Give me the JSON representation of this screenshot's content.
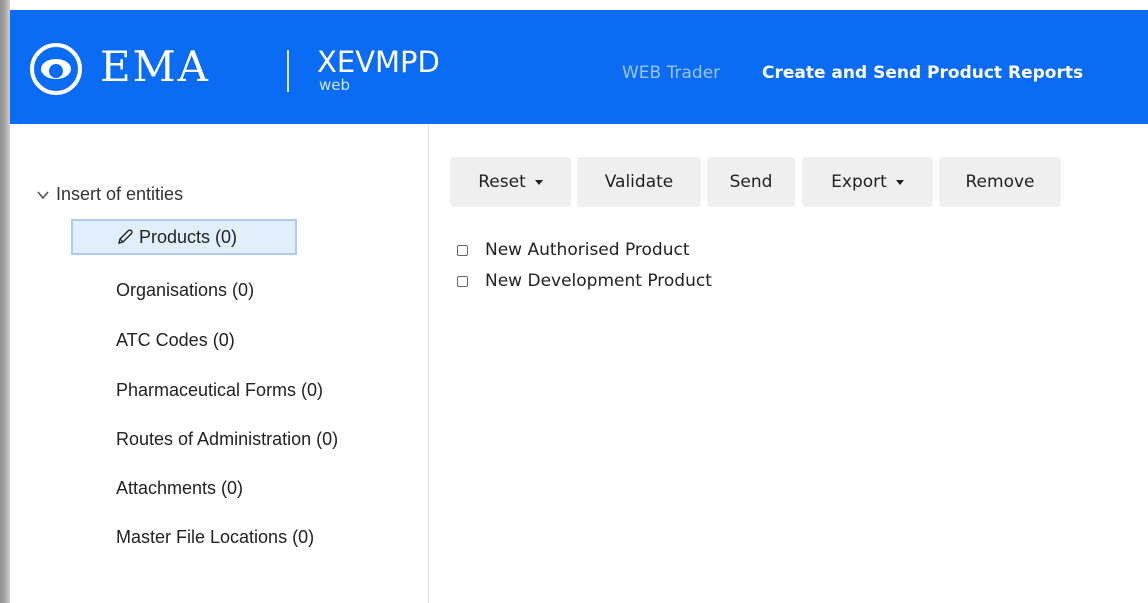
{
  "header": {
    "brand": "EMA",
    "product_name": "XEVMPD",
    "product_sub": "web",
    "nav": [
      {
        "label": "WEB Trader",
        "state": "muted"
      },
      {
        "label": "Create and Send Product Reports",
        "state": "active"
      }
    ],
    "logo_icon": "ema-eye-logo",
    "colors": {
      "header_bg": "#0a6cf4"
    }
  },
  "sidebar": {
    "root_label": "Insert of entities",
    "root_icon": "chevron-down-icon",
    "items": [
      {
        "label": "Products (0)",
        "selected": true,
        "icon": "pencil-icon"
      },
      {
        "label": "Organisations (0)"
      },
      {
        "label": "ATC Codes (0)"
      },
      {
        "label": "Pharmaceutical Forms (0)"
      },
      {
        "label": "Routes of Administration (0)"
      },
      {
        "label": "Attachments (0)"
      },
      {
        "label": "Master File Locations (0)"
      }
    ]
  },
  "toolbar": {
    "reset_label": "Reset",
    "validate_label": "Validate",
    "send_label": "Send",
    "export_label": "Export",
    "remove_label": "Remove"
  },
  "options": [
    {
      "label": "New Authorised Product",
      "checked": false
    },
    {
      "label": "New Development Product",
      "checked": false
    }
  ]
}
